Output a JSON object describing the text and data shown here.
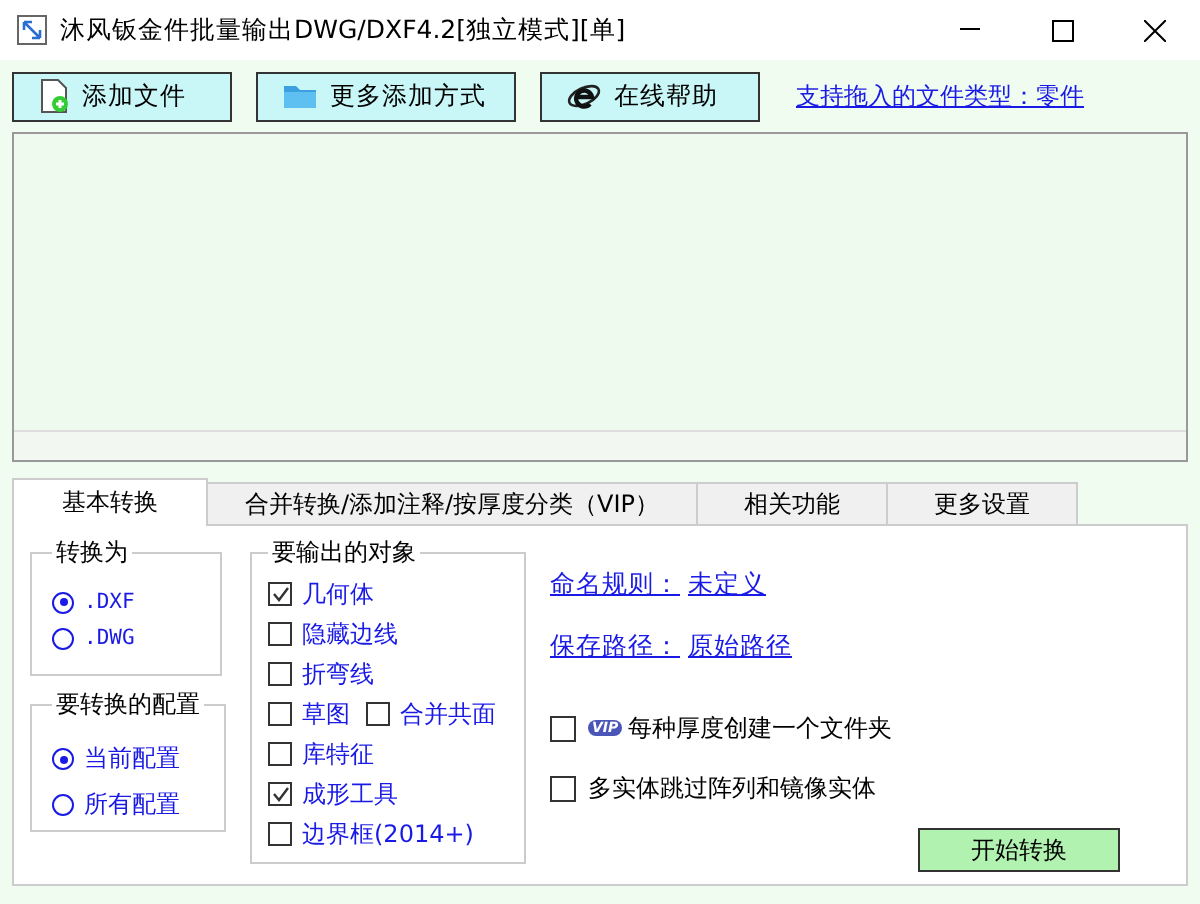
{
  "window": {
    "title": "沐风钣金件批量输出DWG/DXF4.2[独立模式][单]"
  },
  "toolbar": {
    "buttons": [
      {
        "label": "添加文件",
        "kind": "file"
      },
      {
        "label": "更多添加方式",
        "kind": "folder"
      },
      {
        "label": "在线帮助",
        "kind": "browser"
      }
    ],
    "link": "支持拖入的文件类型：零件"
  },
  "tabs": [
    {
      "label": "基本转换",
      "selected": true
    },
    {
      "label": "合并转换/添加注释/按厚度分类（VIP）",
      "selected": false
    },
    {
      "label": "相关功能",
      "selected": false
    },
    {
      "label": "更多设置",
      "selected": false
    }
  ],
  "convert_to": {
    "title": "转换为",
    "options": [
      {
        "label": ".DXF",
        "selected": true
      },
      {
        "label": ".DWG",
        "selected": false
      }
    ]
  },
  "configurations": {
    "title": "要转换的配置",
    "options": [
      {
        "label": "当前配置",
        "selected": true
      },
      {
        "label": "所有配置",
        "selected": false
      }
    ]
  },
  "objects": {
    "title": "要输出的对象",
    "rows": [
      [
        {
          "label": "几何体",
          "checked": true
        }
      ],
      [
        {
          "label": "隐藏边线",
          "checked": false
        }
      ],
      [
        {
          "label": "折弯线",
          "checked": false
        }
      ],
      [
        {
          "label": "草图",
          "checked": false
        },
        {
          "label": "合并共面",
          "checked": false
        }
      ],
      [
        {
          "label": "库特征",
          "checked": false
        }
      ],
      [
        {
          "label": "成形工具",
          "checked": true
        }
      ],
      [
        {
          "label": "边界框(2014+)",
          "checked": false
        }
      ]
    ]
  },
  "naming_rule": {
    "label": "命名规则：",
    "value": "未定义"
  },
  "save_path": {
    "label": "保存路径：",
    "value": "原始路径"
  },
  "options": [
    {
      "label": "每种厚度创建一个文件夹",
      "checked": false,
      "badge": "VIP"
    },
    {
      "label": "多实体跳过阵列和镜像实体",
      "checked": false
    }
  ],
  "start_button": "开始转换"
}
